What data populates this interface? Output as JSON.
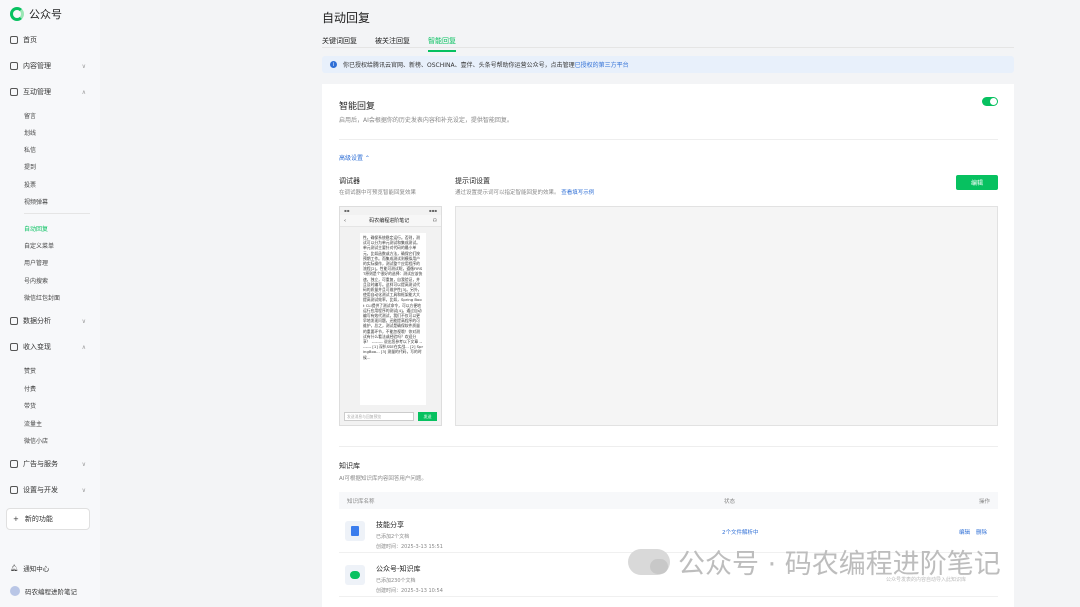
{
  "brand": {
    "name": "公众号"
  },
  "sidebar": {
    "home": "首页",
    "content_mgmt": "内容管理",
    "interaction_mgmt": "互动管理",
    "interaction_items": [
      "留言",
      "划线",
      "私信",
      "提到",
      "投票",
      "视频弹幕"
    ],
    "auto_items": [
      "自动回复",
      "自定义菜单",
      "用户管理",
      "号内搜索",
      "微信红包封面"
    ],
    "data_analysis": "数据分析",
    "monetization": "收入变现",
    "monetization_items": [
      "赞赏",
      "付费",
      "带货",
      "流量主",
      "微信小店"
    ],
    "ads": "广告与服务",
    "settings": "设置与开发",
    "new_feature": "新的功能",
    "notifications": "通知中心",
    "account_name": "码农编程进阶笔记"
  },
  "page": {
    "title": "自动回复",
    "tabs": [
      "关键词回复",
      "被关注回复",
      "智能回复"
    ],
    "notice_text": "你已授权给腾讯云官网、新榜、OSCHINA、壹伴、头条号帮助你运营公众号，点击管理",
    "notice_link": "已授权的第三方平台"
  },
  "smart_reply": {
    "title": "智能回复",
    "desc": "启用后，AI会根据你的历史发表内容和补充设定，提供智能回复。",
    "enabled": true,
    "advanced": "高级设置 ⌃",
    "debugger_title": "调试器",
    "debugger_desc": "在调试器中可预览智能回复效果",
    "prompt_title": "提示词设置",
    "prompt_desc": "通过设置提示词可以指定智能回复的效果。",
    "prompt_link": "查看填写示例",
    "edit_label": "编辑",
    "phone_title": "码农编程进阶笔记",
    "phone_message": "性。确保系统稳定运行。否则，测试可以分为单元测试和集成测试。单元测试主要针对代码的最小单元，比如函数或方法，确保它们按预期工作。而集成测试则模拟用户的实际操作，测试整个应用程序的流程[2]。性能可测试呢，遵循FIRST原则是个很好的选择：测试应该快速，独立，可重复，自我验证，并且及时编写。这样可以提高测试代码的质量并且可维护性[3]。另外，使用自动化测试工具和框架能大大提高测试效率，比如，Spring Boot CLI提供了测试命令，可以方便地运行应用程序的测试[4]。通过自动编写有效代测试，我们不仅可以更早地发现问题，还能提高程序的可维护，总之，测试是确保软件质量的重要环节，不能忽视哦！你对测试有什么看法或经验吗？欢迎分享！ -------- 说出您参考以下文章 -------- [1] 深扒SSE在实战... [2] SpringBoo... [3] 测量的代码，写的时候...",
    "phone_input_placeholder": "发送消息与回复预览",
    "phone_send": "发送"
  },
  "kb": {
    "title": "知识库",
    "desc": "AI可根据知识库内容回答用户问题。",
    "headers": [
      "知识库名称",
      "状态",
      "操作"
    ],
    "rows": [
      {
        "name": "技能分享",
        "count": "已添加2个文档",
        "time": "创建时间：2025-3-13 15:51",
        "status": "2个文件解析中",
        "ops": [
          "编辑",
          "删除"
        ]
      },
      {
        "name": "公众号-知识库",
        "count": "已添加230个文档",
        "time": "创建时间：2025-3-13 10:54",
        "status": "",
        "ops": []
      }
    ]
  },
  "watermark": {
    "text": "公众号 · 码农编程进阶笔记",
    "sub": "公众号发表的内容自动导入此知识库"
  },
  "colors": {
    "accent": "#07c160",
    "link": "#2f6fd6"
  }
}
